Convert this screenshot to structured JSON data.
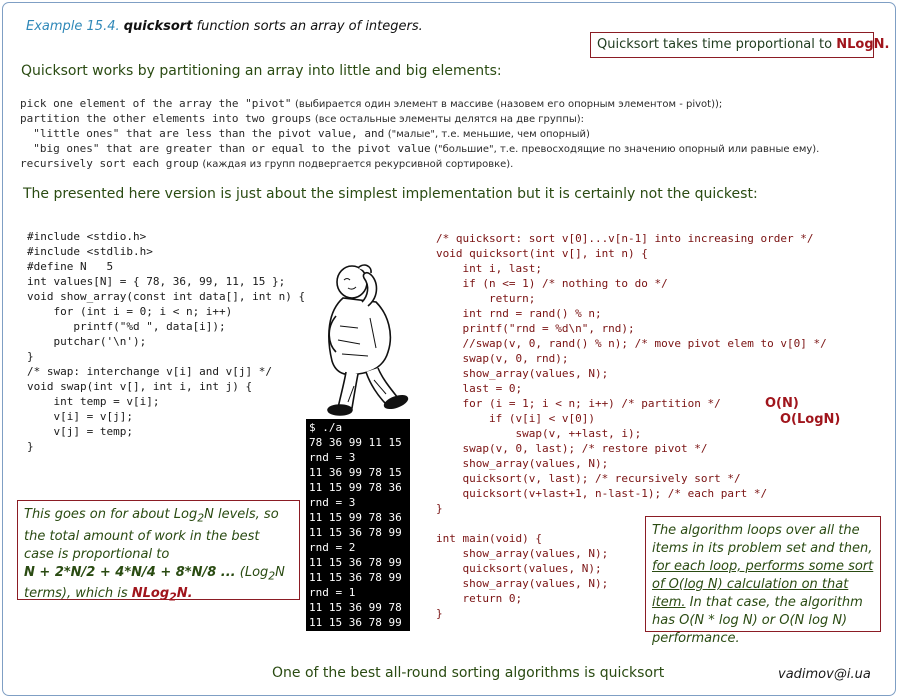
{
  "title": {
    "label": "Example 15.4.",
    "keyword": "quicksort",
    "rest": "function sorts an array of integers."
  },
  "top_box": {
    "text": "Quicksort takes time proportional to",
    "emph": "NLogN."
  },
  "intro": "Quicksort works by partitioning an array into little and big elements:",
  "algo": [
    {
      "code": "pick one element of the array the \"pivot\"",
      "note": "(выбирается один элемент в массиве (назовем его опорным элементом - pivot));"
    },
    {
      "code": "partition the other elements into two groups",
      "note": "(все остальные элементы делятся на две группы):"
    },
    {
      "code": "  \"little ones\" that are less than the pivot value, and",
      "note": "(\"малые\", т.е. меньшие, чем опорный)"
    },
    {
      "code": "  \"big ones\" that are greater than or equal to the pivot value",
      "note": "(\"большие\", т.е. превосходящие по значению опорный или равные ему)."
    },
    {
      "code": "recursively sort each group",
      "note": "(каждая из групп подвергается рекурсивной сортировке)."
    }
  ],
  "presented": "The presented here version is just about the simplest implementation but it is certainly not the quickest:",
  "code_left": "#include <stdio.h>\n#include <stdlib.h>\n#define N   5\nint values[N] = { 78, 36, 99, 11, 15 };\nvoid show_array(const int data[], int n) {\n    for (int i = 0; i < n; i++)\n       printf(\"%d \", data[i]);\n    putchar('\\n');\n}\n/* swap: interchange v[i] and v[j] */\nvoid swap(int v[], int i, int j) {\n    int temp = v[i];\n    v[i] = v[j];\n    v[j] = temp;\n}",
  "code_right": "/* quicksort: sort v[0]...v[n-1] into increasing order */\nvoid quicksort(int v[], int n) {\n    int i, last;\n    if (n <= 1) /* nothing to do */\n        return;\n    int rnd = rand() % n;\n    printf(\"rnd = %d\\n\", rnd);\n    //swap(v, 0, rand() % n); /* move pivot elem to v[0] */\n    swap(v, 0, rnd);\n    show_array(values, N);\n    last = 0;\n    for (i = 1; i < n; i++) /* partition */\n        if (v[i] < v[0])\n            swap(v, ++last, i);\n    swap(v, 0, last); /* restore pivot */\n    show_array(values, N);\n    quicksort(v, last); /* recursively sort */\n    quicksort(v+last+1, n-last-1); /* each part */\n}\n\nint main(void) {\n    show_array(values, N);\n    quicksort(values, N);\n    show_array(values, N);\n    return 0;\n}",
  "complexity": {
    "loop": "O(N)",
    "levels": "O(LogN)"
  },
  "terminal": "$ ./a\n78 36 99 11 15\nrnd = 3\n11 36 99 78 15\n11 15 99 78 36\nrnd = 3\n11 15 99 78 36\n11 15 36 78 99\nrnd = 2\n11 15 36 78 99\n11 15 36 78 99\nrnd = 1\n11 15 36 99 78\n11 15 36 78 99\n11 15 36 78 99",
  "box_left": {
    "line1": "This goes on for about Log",
    "sub": "2",
    "line1b": "N levels, so the total amount of work in the best case is proportional to",
    "series": "N + 2*N/2 + 4*N/4 + 8*N/8 ...",
    "terms_a": "(Log",
    "terms_b": "N terms),",
    "which": "which is",
    "result_a": "NLog",
    "result_b": "N."
  },
  "box_right": {
    "before": "The algorithm loops over all the items in its problem set and then,",
    "underlined": "for each loop, performs some sort of O(log N) calculation on that item.",
    "after": "In that case, the algorithm has O(N * log N) or O(N log N) performance."
  },
  "footer": "One of the best all-round sorting algorithms is quicksort",
  "email": "vadimov@i.ua",
  "colors": {
    "accent_red": "#a0151c",
    "text_green": "#2a4b12",
    "title_blue": "#2f88b8",
    "code_dark_red": "#7a1212"
  },
  "icons": {
    "cartoon": "thinking-man-illustration"
  }
}
